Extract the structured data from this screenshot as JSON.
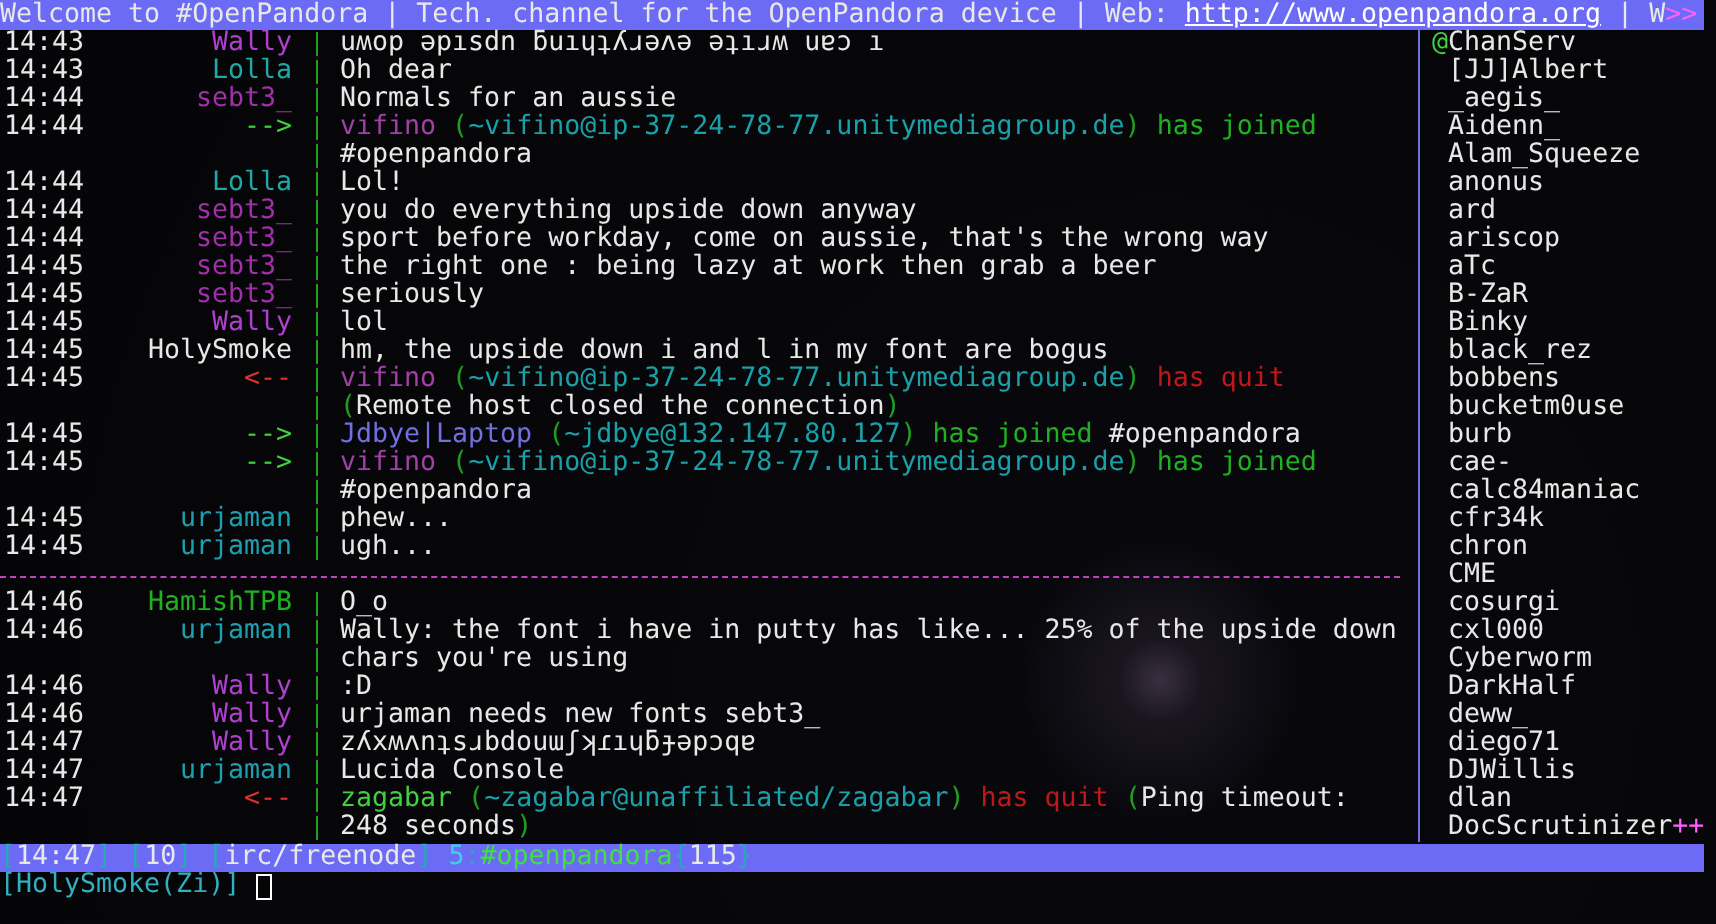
{
  "title_bar": {
    "segments": [
      {
        "text": "Welcome to #OpenPandora | Tech. channel for the OpenPandora device | Web: ",
        "kind": "text"
      },
      {
        "text": "http://www.openpandora.org",
        "kind": "link"
      },
      {
        "text": " | W",
        "kind": "text"
      },
      {
        "text": ">>",
        "kind": "more"
      }
    ]
  },
  "messages": [
    {
      "kind": "message",
      "time": "14:43",
      "prefix": {
        "text": "Wally",
        "kind": "nick",
        "color": "#b040d0"
      },
      "segments": [
        {
          "text": "uʍop ǝpısdn ƃuıɥʇʎɹǝʌǝ ǝʇıɹʍ uɐɔ ı",
          "kind": "text"
        }
      ]
    },
    {
      "kind": "message",
      "time": "14:43",
      "prefix": {
        "text": "Lolla",
        "kind": "nick",
        "color": "#20a8a8"
      },
      "segments": [
        {
          "text": "Oh dear",
          "kind": "text"
        }
      ]
    },
    {
      "kind": "message",
      "time": "14:44",
      "prefix": {
        "text": "sebt3_",
        "kind": "nick",
        "color": "#a030a8"
      },
      "segments": [
        {
          "text": "Normals for an aussie",
          "kind": "text"
        }
      ]
    },
    {
      "kind": "message",
      "time": "14:44",
      "prefix": {
        "text": "-->",
        "kind": "join"
      },
      "segments": [
        {
          "text": "vifino",
          "kind": "nick",
          "color": "#a040a8"
        },
        {
          "text": " (",
          "kind": "paren"
        },
        {
          "text": "~vifino@ip-37-24-78-77.unitymediagroup.de",
          "kind": "host"
        },
        {
          "text": ")",
          "kind": "paren"
        },
        {
          "text": " has joined ",
          "kind": "joined"
        },
        {
          "text": "#openpandora",
          "kind": "text"
        }
      ]
    },
    {
      "kind": "message",
      "time": "14:44",
      "prefix": {
        "text": "Lolla",
        "kind": "nick",
        "color": "#20a8a8"
      },
      "segments": [
        {
          "text": "Lol!",
          "kind": "text"
        }
      ]
    },
    {
      "kind": "message",
      "time": "14:44",
      "prefix": {
        "text": "sebt3_",
        "kind": "nick",
        "color": "#a030a8"
      },
      "segments": [
        {
          "text": "you do everything upside down anyway",
          "kind": "text"
        }
      ]
    },
    {
      "kind": "message",
      "time": "14:44",
      "prefix": {
        "text": "sebt3_",
        "kind": "nick",
        "color": "#a030a8"
      },
      "segments": [
        {
          "text": "sport before workday, come on aussie, that's the wrong way",
          "kind": "text"
        }
      ]
    },
    {
      "kind": "message",
      "time": "14:45",
      "prefix": {
        "text": "sebt3_",
        "kind": "nick",
        "color": "#a030a8"
      },
      "segments": [
        {
          "text": "the right one : being lazy at work then grab a beer",
          "kind": "text"
        }
      ]
    },
    {
      "kind": "message",
      "time": "14:45",
      "prefix": {
        "text": "sebt3_",
        "kind": "nick",
        "color": "#a030a8"
      },
      "segments": [
        {
          "text": "seriously",
          "kind": "text"
        }
      ]
    },
    {
      "kind": "message",
      "time": "14:45",
      "prefix": {
        "text": "Wally",
        "kind": "nick",
        "color": "#b040d0"
      },
      "segments": [
        {
          "text": "lol",
          "kind": "text"
        }
      ]
    },
    {
      "kind": "message",
      "time": "14:45",
      "prefix": {
        "text": "HolySmoke",
        "kind": "nick",
        "color": "#e8e8e8"
      },
      "segments": [
        {
          "text": "hm, the upside down i and l in my font are bogus",
          "kind": "text"
        }
      ]
    },
    {
      "kind": "message",
      "time": "14:45",
      "prefix": {
        "text": "<--",
        "kind": "quit"
      },
      "segments": [
        {
          "text": "vifino",
          "kind": "nick",
          "color": "#a040a8"
        },
        {
          "text": " (",
          "kind": "paren"
        },
        {
          "text": "~vifino@ip-37-24-78-77.unitymediagroup.de",
          "kind": "host"
        },
        {
          "text": ")",
          "kind": "paren"
        },
        {
          "text": " has quit ",
          "kind": "quit"
        },
        {
          "text": "(",
          "kind": "paren"
        },
        {
          "text": "Remote host closed the connection",
          "kind": "text"
        },
        {
          "text": ")",
          "kind": "paren"
        }
      ]
    },
    {
      "kind": "message",
      "time": "14:45",
      "prefix": {
        "text": "-->",
        "kind": "join"
      },
      "segments": [
        {
          "text": "Jdbye|Laptop",
          "kind": "nick",
          "color": "#7070e0"
        },
        {
          "text": " (",
          "kind": "paren"
        },
        {
          "text": "~jdbye@132.147.80.127",
          "kind": "host"
        },
        {
          "text": ")",
          "kind": "paren"
        },
        {
          "text": " has joined ",
          "kind": "joined"
        },
        {
          "text": "#openpandora",
          "kind": "text"
        }
      ]
    },
    {
      "kind": "message",
      "time": "14:45",
      "prefix": {
        "text": "-->",
        "kind": "join"
      },
      "segments": [
        {
          "text": "vifino",
          "kind": "nick",
          "color": "#a040a8"
        },
        {
          "text": " (",
          "kind": "paren"
        },
        {
          "text": "~vifino@ip-37-24-78-77.unitymediagroup.de",
          "kind": "host"
        },
        {
          "text": ")",
          "kind": "paren"
        },
        {
          "text": " has joined ",
          "kind": "joined"
        },
        {
          "text": "#openpandora",
          "kind": "text"
        }
      ]
    },
    {
      "kind": "message",
      "time": "14:45",
      "prefix": {
        "text": "urjaman",
        "kind": "nick",
        "color": "#1aa0b0"
      },
      "segments": [
        {
          "text": "phew...",
          "kind": "text"
        }
      ]
    },
    {
      "kind": "message",
      "time": "14:45",
      "prefix": {
        "text": "urjaman",
        "kind": "nick",
        "color": "#1aa0b0"
      },
      "segments": [
        {
          "text": "ugh...",
          "kind": "text"
        }
      ]
    },
    {
      "kind": "read_marker"
    },
    {
      "kind": "message",
      "time": "14:46",
      "prefix": {
        "text": "HamishTPB",
        "kind": "nick",
        "color": "#20b020"
      },
      "segments": [
        {
          "text": "O_o",
          "kind": "text"
        }
      ]
    },
    {
      "kind": "message",
      "time": "14:46",
      "prefix": {
        "text": "urjaman",
        "kind": "nick",
        "color": "#1aa0b0"
      },
      "segments": [
        {
          "text": "Wally: the font i have in putty has like... 25% of the upside down chars you're using",
          "kind": "text"
        }
      ]
    },
    {
      "kind": "message",
      "time": "14:46",
      "prefix": {
        "text": "Wally",
        "kind": "nick",
        "color": "#b040d0"
      },
      "segments": [
        {
          "text": ":D",
          "kind": "text"
        }
      ]
    },
    {
      "kind": "message",
      "time": "14:46",
      "prefix": {
        "text": "Wally",
        "kind": "nick",
        "color": "#b040d0"
      },
      "segments": [
        {
          "text": "urjaman needs new fonts sebt3_",
          "kind": "text"
        }
      ]
    },
    {
      "kind": "message",
      "time": "14:47",
      "prefix": {
        "text": "Wally",
        "kind": "nick",
        "color": "#b040d0"
      },
      "segments": [
        {
          "text": "zʎxʍʌnʇsɹbdouɯʃʞɾıɥƃɟǝpɔqɐ",
          "kind": "text"
        }
      ]
    },
    {
      "kind": "message",
      "time": "14:47",
      "prefix": {
        "text": "urjaman",
        "kind": "nick",
        "color": "#1aa0b0"
      },
      "segments": [
        {
          "text": "Lucida Console",
          "kind": "text"
        }
      ]
    },
    {
      "kind": "message",
      "time": "14:47",
      "prefix": {
        "text": "<--",
        "kind": "quit"
      },
      "segments": [
        {
          "text": "zagabar",
          "kind": "nick",
          "color": "#40d040"
        },
        {
          "text": " (",
          "kind": "paren"
        },
        {
          "text": "~zagabar@unaffiliated/zagabar",
          "kind": "host"
        },
        {
          "text": ")",
          "kind": "paren"
        },
        {
          "text": " has quit ",
          "kind": "quit"
        },
        {
          "text": "(",
          "kind": "paren"
        },
        {
          "text": "Ping timeout: 248 seconds",
          "kind": "text"
        },
        {
          "text": ")",
          "kind": "paren"
        }
      ]
    }
  ],
  "nicklist": {
    "nicks": [
      {
        "mode": "@",
        "name": "ChanServ"
      },
      {
        "name": "[JJ]Albert"
      },
      {
        "name": "_aegis_"
      },
      {
        "name": "Aidenn_"
      },
      {
        "name": "Alam_Squeeze"
      },
      {
        "name": "anonus"
      },
      {
        "name": "ard"
      },
      {
        "name": "ariscop"
      },
      {
        "name": "aTc"
      },
      {
        "name": "B-ZaR"
      },
      {
        "name": "Binky"
      },
      {
        "name": "black_rez"
      },
      {
        "name": "bobbens"
      },
      {
        "name": "bucketm0use"
      },
      {
        "name": "burb"
      },
      {
        "name": "cae-"
      },
      {
        "name": "calc84maniac"
      },
      {
        "name": "cfr34k"
      },
      {
        "name": "chron"
      },
      {
        "name": "CME"
      },
      {
        "name": "cosurgi"
      },
      {
        "name": "cxl000"
      },
      {
        "name": "Cyberworm"
      },
      {
        "name": "DarkHalf"
      },
      {
        "name": "deww_"
      },
      {
        "name": "diego71"
      },
      {
        "name": "DJWillis"
      },
      {
        "name": "dlan"
      },
      {
        "name": "DocScrutinizer"
      }
    ],
    "more": "++"
  },
  "status_bar": {
    "segments": [
      {
        "text": "[",
        "kind": "delim"
      },
      {
        "text": "14:47",
        "kind": "text"
      },
      {
        "text": "] [",
        "kind": "delim"
      },
      {
        "text": "10",
        "kind": "text"
      },
      {
        "text": "] [",
        "kind": "delim"
      },
      {
        "text": "irc/freenode",
        "kind": "text"
      },
      {
        "text": "] ",
        "kind": "delim"
      },
      {
        "text": "5",
        "kind": "number"
      },
      {
        "text": ":",
        "kind": "delim"
      },
      {
        "text": "#openpandora",
        "kind": "channel"
      },
      {
        "text": "{",
        "kind": "delim"
      },
      {
        "text": "115",
        "kind": "text"
      },
      {
        "text": "}",
        "kind": "delim"
      }
    ]
  },
  "input": {
    "prompt": "[HolySmoke(Zi)]"
  }
}
